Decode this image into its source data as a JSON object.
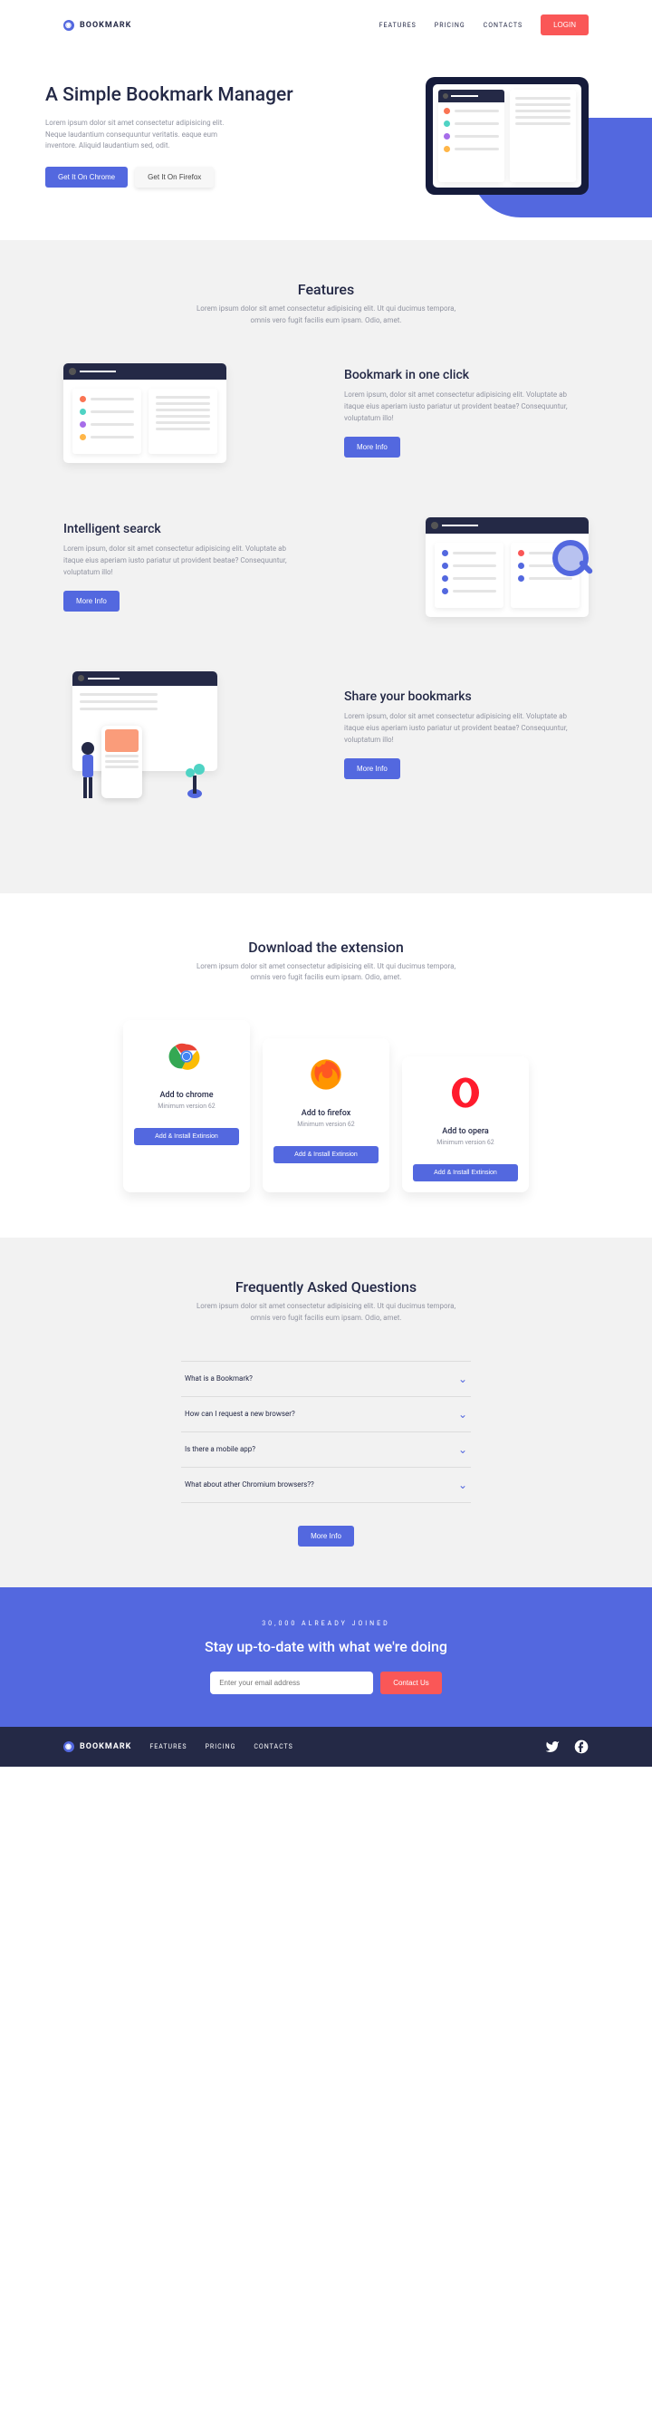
{
  "brand": "BOOKMARK",
  "nav": {
    "features": "FEATURES",
    "pricing": "PRICING",
    "contacts": "CONTACTS",
    "login": "LOGIN"
  },
  "hero": {
    "title": "A Simple Bookmark Manager",
    "desc": "Lorem ipsum dolor sit amet consectetur adipisicing elit. Neque laudantium consequuntur veritatis. eaque eum inventore. Aliquid laudantium sed, odit.",
    "chrome": "Get It On Chrome",
    "firefox": "Get It On Firefox"
  },
  "features": {
    "title": "Features",
    "sub": "Lorem ipsum dolor sit amet consectetur adipisicing elit. Ut qui ducimus tempora, omnis vero fugit facilis eum ipsam. Odio, amet.",
    "items": [
      {
        "title": "Bookmark in one click",
        "desc": "Lorem ipsum, dolor sit amet consectetur adipisicing elit. Voluptate ab itaque eius aperiam iusto pariatur ut provident beatae? Consequuntur, voluptatum illo!",
        "btn": "More Info"
      },
      {
        "title": "Intelligent searck",
        "desc": "Lorem ipsum, dolor sit amet consectetur adipisicing elit. Voluptate ab itaque eius aperiam iusto pariatur ut provident beatae? Consequuntur, voluptatum illo!",
        "btn": "More Info"
      },
      {
        "title": "Share your bookmarks",
        "desc": "Lorem ipsum, dolor sit amet consectetur adipisicing elit. Voluptate ab itaque eius aperiam iusto pariatur ut provident beatae? Consequuntur, voluptatum illo!",
        "btn": "More Info"
      }
    ]
  },
  "downloads": {
    "title": "Download the extension",
    "sub": "Lorem ipsum dolor sit amet consectetur adipisicing elit. Ut qui ducimus tempora, omnis vero fugit facilis eum ipsam. Odio, amet.",
    "cards": [
      {
        "name": "Add to chrome",
        "ver": "Minimum version 62",
        "btn": "Add & Install Extinsion"
      },
      {
        "name": "Add to firefox",
        "ver": "Minimum version 62",
        "btn": "Add & Install Extinsion"
      },
      {
        "name": "Add to opera",
        "ver": "Minimum version 62",
        "btn": "Add & Install Extinsion"
      }
    ]
  },
  "faq": {
    "title": "Frequently Asked Questions",
    "sub": "Lorem ipsum dolor sit amet consectetur adipisicing elit. Ut qui ducimus tempora, omnis vero fugit facilis eum ipsam. Odio, amet.",
    "items": [
      "What is a Bookmark?",
      "How can I request a new browser?",
      "Is there a mobile app?",
      "What about ather Chromium browsers??"
    ],
    "more": "More Info"
  },
  "cta": {
    "label": "30,000 ALREADY JOINED",
    "title": "Stay up-to-date with what we're doing",
    "placeholder": "Enter your email address",
    "btn": "Contact Us"
  },
  "footer": {
    "features": "FEATURES",
    "pricing": "PRICING",
    "contacts": "CONTACTS"
  }
}
